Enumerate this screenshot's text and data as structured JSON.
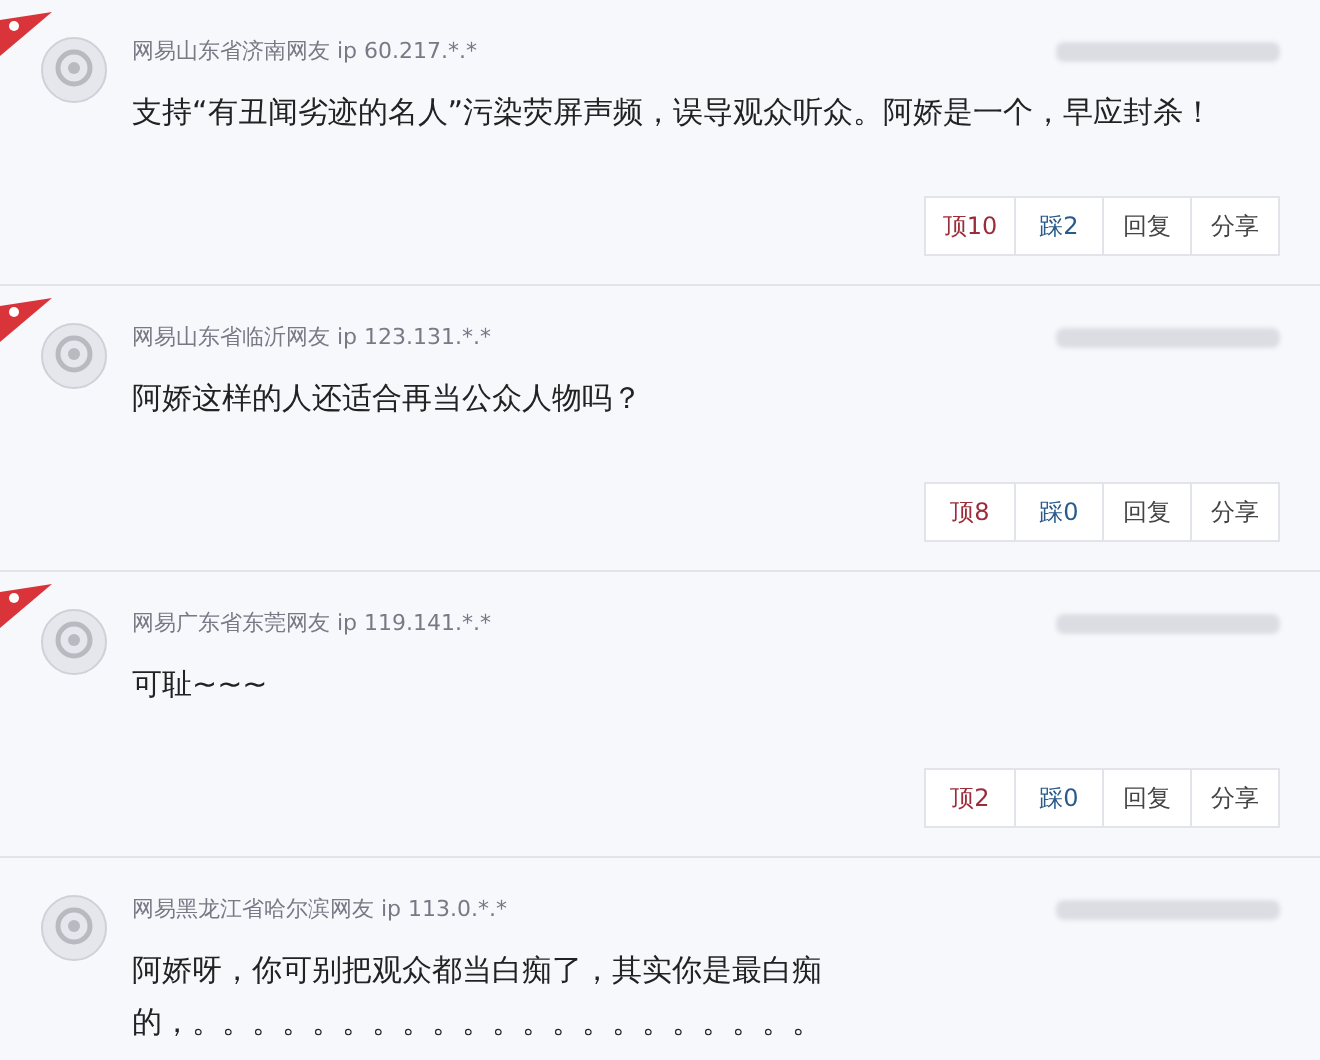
{
  "comments": [
    {
      "flagged": true,
      "author": "网易山东省济南网友 ip 60.217.*.*",
      "content": "支持“有丑闻劣迹的名人”污染荧屏声频，误导观众听众。阿娇是一个，早应封杀！",
      "actions": [
        {
          "kind": "up",
          "label": "顶10"
        },
        {
          "kind": "down",
          "label": "踩2"
        },
        {
          "kind": "plain",
          "label": "回复"
        },
        {
          "kind": "plain",
          "label": "分享"
        }
      ]
    },
    {
      "flagged": true,
      "author": "网易山东省临沂网友 ip 123.131.*.*",
      "content": "阿娇这样的人还适合再当公众人物吗？",
      "actions": [
        {
          "kind": "up",
          "label": "顶8"
        },
        {
          "kind": "down",
          "label": "踩0"
        },
        {
          "kind": "plain",
          "label": "回复"
        },
        {
          "kind": "plain",
          "label": "分享"
        }
      ]
    },
    {
      "flagged": true,
      "author": "网易广东省东莞网友 ip 119.141.*.*",
      "content": "可耻~~~",
      "actions": [
        {
          "kind": "up",
          "label": "顶2"
        },
        {
          "kind": "down",
          "label": "踩0"
        },
        {
          "kind": "plain",
          "label": "回复"
        },
        {
          "kind": "plain",
          "label": "分享"
        }
      ]
    },
    {
      "flagged": false,
      "author": "网易黑龙江省哈尔滨网友 ip 113.0.*.*",
      "content": "阿娇呀，你可别把观众都当白痴了，其实你是最白痴的，。。。。。。。。。。。。。。。。。。。。。"
    }
  ]
}
